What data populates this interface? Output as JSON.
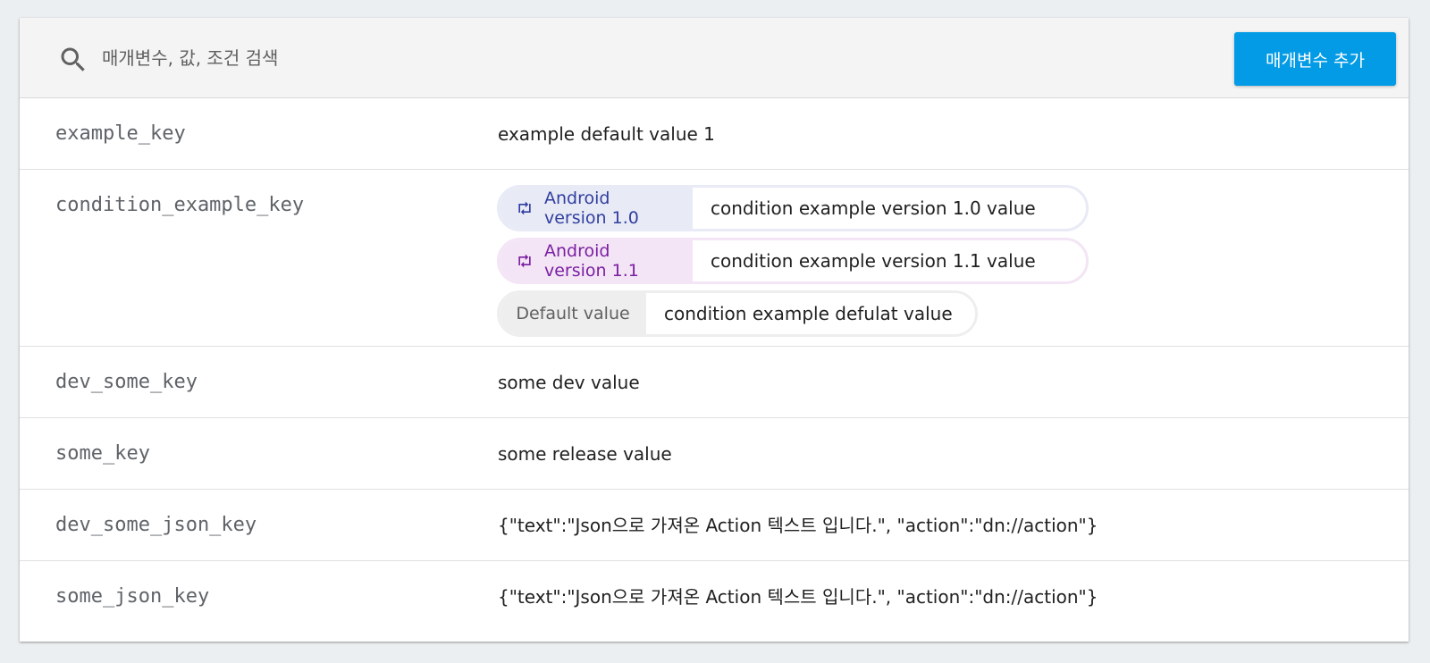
{
  "search": {
    "placeholder": "매개변수, 값, 조건 검색"
  },
  "toolbar": {
    "add_button_label": "매개변수 추가"
  },
  "params": [
    {
      "key": "example_key",
      "value": "example default value 1"
    },
    {
      "key": "condition_example_key",
      "conditions": [
        {
          "label": "Android version 1.0",
          "value": "condition example version 1.0 value",
          "color": "#303f9f",
          "bg": "#e8eaf6"
        },
        {
          "label": "Android version 1.1",
          "value": "condition example version 1.1 value",
          "color": "#7b1fa2",
          "bg": "#f3e5f5"
        }
      ],
      "default": {
        "label": "Default value",
        "value": "condition example defulat value"
      }
    },
    {
      "key": "dev_some_key",
      "value": "some dev value"
    },
    {
      "key": "some_key",
      "value": "some release value"
    },
    {
      "key": "dev_some_json_key",
      "value": "{\"text\":\"Json으로 가져온 Action 텍스트 입니다.\", \"action\":\"dn://action\"}"
    },
    {
      "key": "some_json_key",
      "value": "{\"text\":\"Json으로 가져온 Action 텍스트 입니다.\", \"action\":\"dn://action\"}"
    }
  ],
  "colors": {
    "accent": "#039be5",
    "key_text": "#5f6368"
  }
}
